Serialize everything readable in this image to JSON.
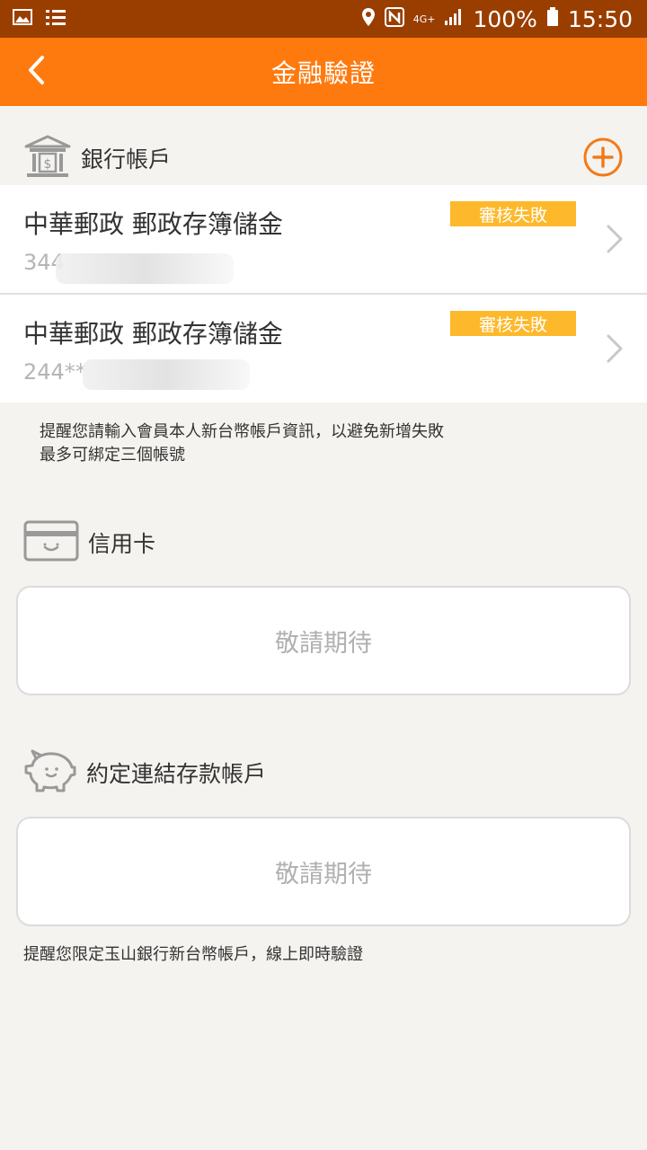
{
  "status_bar": {
    "battery": "100%",
    "time": "15:50",
    "network": "4G+"
  },
  "app_bar": {
    "title": "金融驗證",
    "back_icon": "chevron-left-icon"
  },
  "bank_section": {
    "label": "銀行帳戶",
    "icon": "bank-icon",
    "add_icon": "plus-circle-icon",
    "accounts": [
      {
        "name": "中華郵政 郵政存簿儲金",
        "number": "344",
        "status": "審核失敗"
      },
      {
        "name": "中華郵政 郵政存簿儲金",
        "number": "244**",
        "status": "審核失敗"
      }
    ],
    "notice_lines": [
      "提醒您請輸入會員本人新台幣帳戶資訊，以避免新增失敗",
      "最多可綁定三個帳號"
    ]
  },
  "credit_section": {
    "label": "信用卡",
    "icon": "credit-card-icon",
    "placeholder": "敬請期待"
  },
  "deposit_section": {
    "label": "約定連結存款帳戶",
    "icon": "piggy-bank-icon",
    "placeholder": "敬請期待",
    "notice": "提醒您限定玉山銀行新台幣帳戶，線上即時驗證"
  },
  "colors": {
    "status_bar": "#9a3e00",
    "app_bar": "#ff7a0e",
    "badge": "#fdb92b",
    "accent": "#f27a1a",
    "background": "#f4f3ef"
  }
}
